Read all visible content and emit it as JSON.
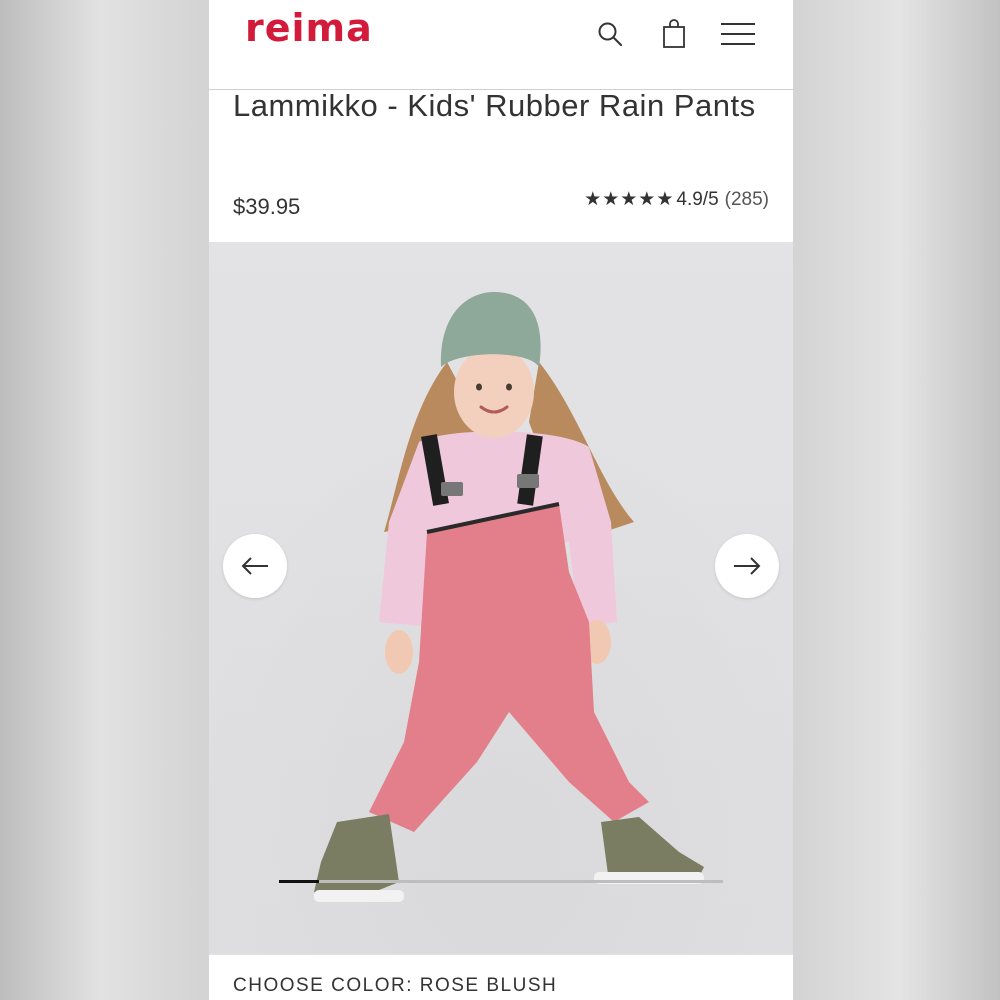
{
  "header": {
    "logo": "reima",
    "icons": [
      "search-icon",
      "bag-icon",
      "menu-icon"
    ]
  },
  "product": {
    "title": "Lammikko - Kids' Rubber Rain Pants",
    "price": "$39.95",
    "rating": {
      "stars": "★★★★★",
      "score": "4.9/5",
      "count": "(285)",
      "value": 4.9
    }
  },
  "gallery": {
    "image_alt": "Child wearing pink rain bib pants, pink sweatshirt, green beanie and olive rubber boots",
    "progress_fraction": 0.09,
    "prev_icon": "arrow-left-icon",
    "next_icon": "arrow-right-icon"
  },
  "colors": {
    "brand": "#d31a3a",
    "pants": "#e27f8a",
    "sweater": "#f0c8dc",
    "beanie": "#8ea89a",
    "boots": "#7a7d62"
  },
  "color_selector": {
    "label": "CHOOSE COLOR: ROSE BLUSH"
  }
}
